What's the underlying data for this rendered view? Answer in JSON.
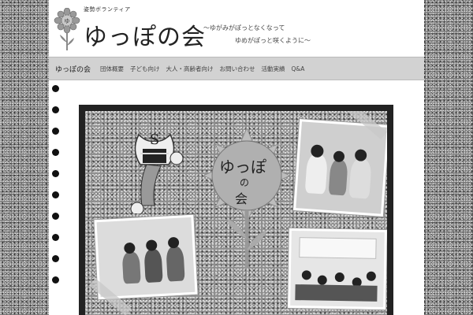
{
  "header": {
    "small_tagline": "姿勢ボランティア",
    "title": "ゆっぽの会",
    "slogan_line1": "〜ゆがみがぽっとなくなって",
    "slogan_line2": "ゆめがぽっと咲くように〜"
  },
  "nav": {
    "brand": "ゆっぽの会",
    "items": [
      "団体概要",
      "子ども向け",
      "大人・高齢者向け",
      "お問い合わせ",
      "活動実績",
      "Q&A"
    ]
  },
  "hero": {
    "sun_text_top": "ゆっぽ",
    "sun_text_mid": "の",
    "sun_text_bottom": "会"
  },
  "colors": {
    "page_bg": "#ffffff",
    "nav_bg": "#d2d2d2",
    "frame": "#222222"
  }
}
